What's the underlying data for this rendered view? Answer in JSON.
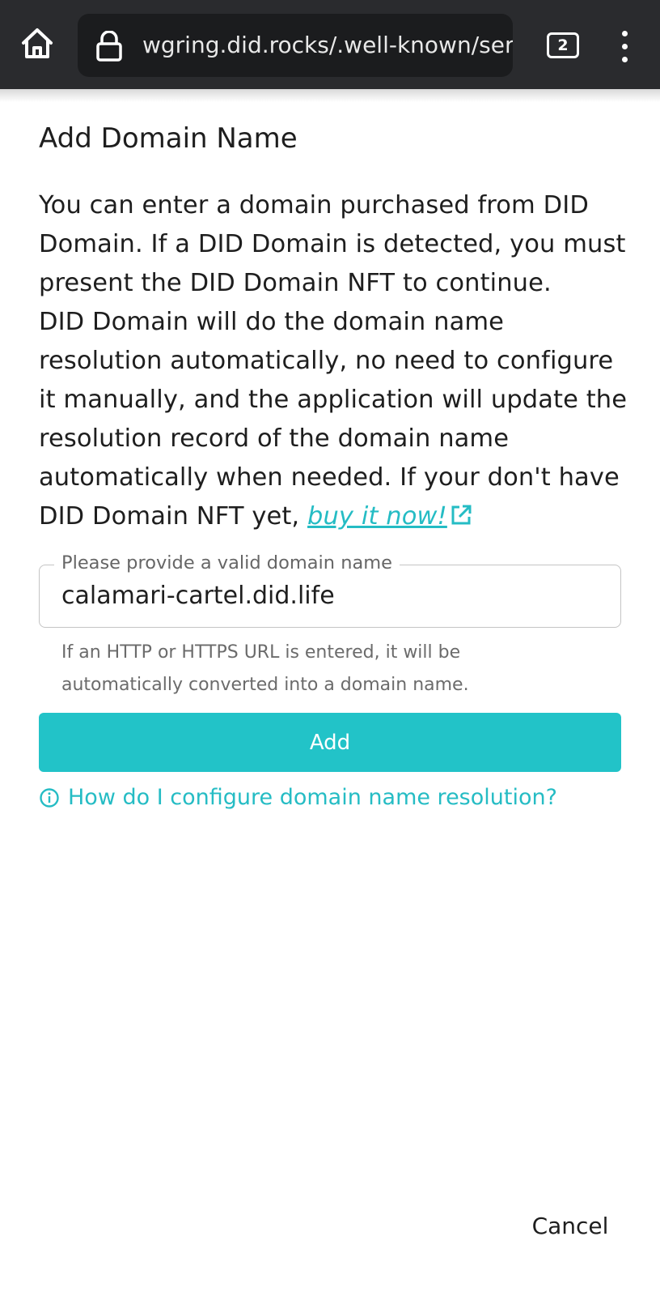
{
  "browser": {
    "url": "wgring.did.rocks/.well-known/servi",
    "tab_count": "2",
    "icons": [
      "home-icon",
      "lock-icon",
      "tabs-icon",
      "more-vert-icon"
    ]
  },
  "dialog": {
    "title": "Add Domain Name",
    "description_1": "You can enter a domain purchased from DID Domain. If a DID Domain is detected, you must present the DID Domain NFT to continue.",
    "description_2": "DID Domain will do the domain name resolution automatically, no need to configure it manually, and the application will update the resolution record of the domain name automatically when needed. If your don't have DID Domain NFT yet,",
    "buy_link": "buy it now!",
    "input": {
      "label": "Please provide a valid domain name",
      "value": "calamari-cartel.did.life"
    },
    "helper_text": "If an HTTP or HTTPS URL is entered, it will be automatically converted into a domain name.",
    "add_label": "Add",
    "help_link": "How do I configure domain name resolution?",
    "cancel_label": "Cancel"
  },
  "colors": {
    "accent": "#22c3c8",
    "link": "#25bcc4",
    "browser_bar": "#2a2b2e",
    "url_box": "#1b1c1e"
  }
}
